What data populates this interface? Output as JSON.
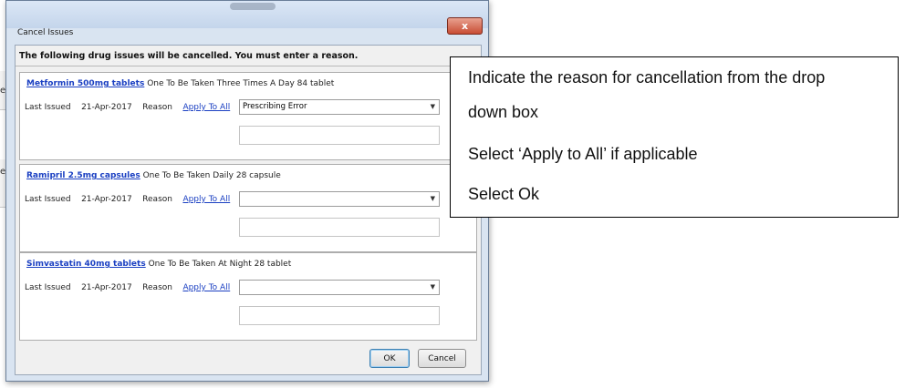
{
  "dialog": {
    "title": "Cancel Issues",
    "close_glyph": "x",
    "header": "The following drug issues will be cancelled. You must enter a reason."
  },
  "issues": [
    {
      "drug": "Metformin 500mg tablets",
      "dosage": "One To Be Taken Three Times A Day  84 tablet",
      "last_issued_label": "Last Issued",
      "last_issued": "21-Apr-2017",
      "reason_label": "Reason",
      "apply_label": "Apply To All",
      "reason_value": "Prescribing Error"
    },
    {
      "drug": "Ramipril 2.5mg capsules",
      "dosage": "One To Be Taken Daily  28 capsule",
      "last_issued_label": "Last Issued",
      "last_issued": "21-Apr-2017",
      "reason_label": "Reason",
      "apply_label": "Apply To All",
      "reason_value": ""
    },
    {
      "drug": "Simvastatin 40mg tablets",
      "dosage": "One To Be Taken At Night  28 tablet",
      "last_issued_label": "Last Issued",
      "last_issued": "21-Apr-2017",
      "reason_label": "Reason",
      "apply_label": "Apply To All",
      "reason_value": ""
    }
  ],
  "buttons": {
    "ok": "OK",
    "cancel": "Cancel"
  },
  "background": {
    "fragment1": "er",
    "fragment2": "ed,"
  },
  "callout": {
    "lines": [
      "Indicate the reason for cancellation from the drop",
      "down box",
      "Select ‘Apply to All’ if applicable",
      "Select Ok"
    ]
  },
  "icons": {
    "dropdown": "chevron-down-icon"
  }
}
